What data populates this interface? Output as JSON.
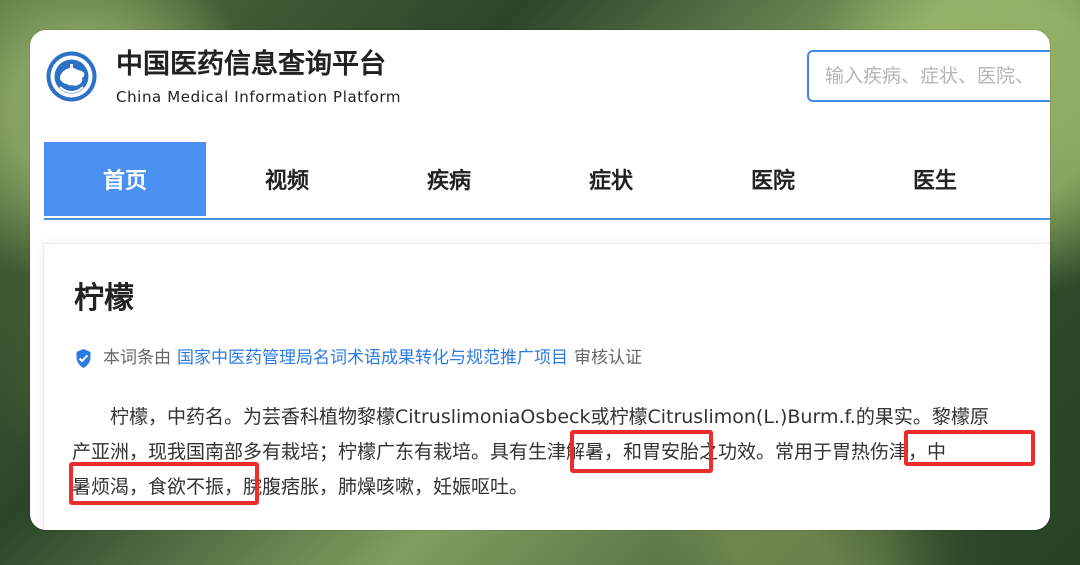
{
  "site": {
    "title": "中国医药信息查询平台",
    "subtitle": "China Medical Information Platform",
    "logo_icon": "medical-emblem-icon"
  },
  "search": {
    "placeholder": "输入疾病、症状、医院、"
  },
  "nav": {
    "items": [
      {
        "label": "首页",
        "active": true
      },
      {
        "label": "视频",
        "active": false
      },
      {
        "label": "疾病",
        "active": false
      },
      {
        "label": "症状",
        "active": false
      },
      {
        "label": "医院",
        "active": false
      },
      {
        "label": "医生",
        "active": false
      }
    ]
  },
  "entry": {
    "title": "柠檬",
    "verification": {
      "icon": "verified-shield-icon",
      "prefix": "本词条由",
      "link_text": "国家中医药管理局名词术语成果转化与规范推广项目",
      "suffix": "审核认证"
    },
    "body_lines": [
      "柠檬，中药名。为芸香科植物黎檬CitruslimoniaOsbeck或柠檬Citruslimon(L.)Burm.f.的果实。黎檬原",
      "产亚洲，现我国南部多有栽培；柠檬广东有栽培。具有生津解暑，和胃安胎之功效。常用于胃热伤津，中",
      "暑烦渴，食欲不振，脘腹痞胀，肺燥咳嗽，妊娠呕吐。"
    ]
  },
  "colors": {
    "accent": "#4990f0",
    "link": "#2c7be5",
    "highlight": "#ee2c2c"
  }
}
